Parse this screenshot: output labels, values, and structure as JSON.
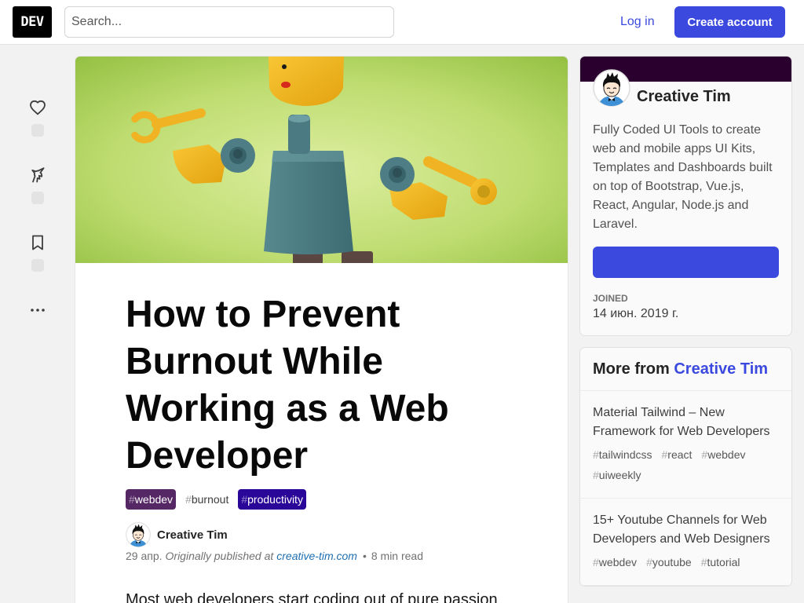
{
  "header": {
    "logo_text": "DEV",
    "search": {
      "placeholder": "Search...",
      "value": ""
    },
    "login_label": "Log in",
    "create_account_label": "Create account"
  },
  "colors": {
    "accent": "#3b49df",
    "page_bg": "#f2f2f2",
    "profile_banner": "#29002e"
  },
  "reactions": {
    "items": [
      {
        "icon": "heart-icon"
      },
      {
        "icon": "unicorn-icon"
      },
      {
        "icon": "bookmark-icon"
      }
    ],
    "more_icon": "ellipsis-icon"
  },
  "tag_prefix": "#",
  "article": {
    "title": "How to Prevent Burnout While Working as a Web Developer",
    "tags": [
      {
        "name": "webdev",
        "bg_color": "#562765",
        "text_color": "#ffffff"
      },
      {
        "name": "burnout",
        "bg_color": "",
        "text_color": "#3d3d3d"
      },
      {
        "name": "productivity",
        "bg_color": "#2a0798",
        "text_color": "#ffffff"
      }
    ],
    "author": {
      "name": "Creative Tim"
    },
    "meta": {
      "date": "29 апр.",
      "published_prefix": "Originally published at",
      "published_link": "creative-tim.com",
      "separator": "•",
      "read_time": "8 min read"
    },
    "body": {
      "first_line": "Most web developers start coding out of pure passion"
    }
  },
  "profile_card": {
    "name": "Creative Tim",
    "description": "Fully Coded UI Tools to create web and mobile apps UI Kits, Templates and Dashboards built on top of Bootstrap, Vue.js, React, Angular, Node.js and Laravel.",
    "joined_label": "JOINED",
    "joined_date": "14 июн. 2019 г."
  },
  "more_from": {
    "prefix": "More from",
    "author": "Creative Tim",
    "posts": [
      {
        "title": "Material Tailwind – New Framework for Web Developers",
        "tags": [
          "tailwindcss",
          "react",
          "webdev",
          "uiweekly"
        ]
      },
      {
        "title": "15+ Youtube Channels for Web Developers and Web Designers",
        "tags": [
          "webdev",
          "youtube",
          "tutorial"
        ]
      }
    ]
  }
}
